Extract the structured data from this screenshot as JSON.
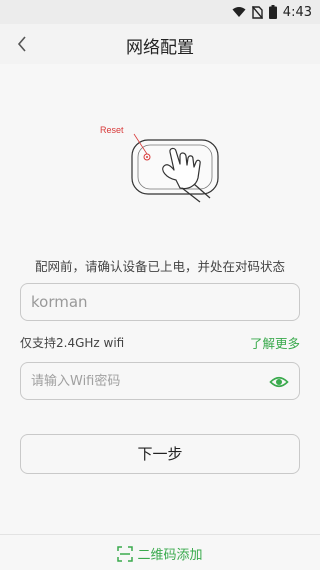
{
  "status_bar": {
    "time": "4:43"
  },
  "header": {
    "title": "网络配置"
  },
  "illustration": {
    "reset_label": "Reset"
  },
  "instruction": "配网前，请确认设备已上电，并处在对码状态",
  "wifi_name_field": {
    "value": "korman"
  },
  "support_note": "仅支持2.4GHz wifi",
  "learn_more_label": "了解更多",
  "password_field": {
    "placeholder": "请输入Wifi密码"
  },
  "next_button_label": "下一步",
  "bottom": {
    "qr_add_label": "二维码添加"
  },
  "colors": {
    "accent": "#3aaa4d",
    "reset_red": "#d83a3a"
  },
  "icons": [
    "wifi-icon",
    "no-sim-icon",
    "battery-icon",
    "back-arrow-icon",
    "eye-icon",
    "scan-qr-icon"
  ]
}
